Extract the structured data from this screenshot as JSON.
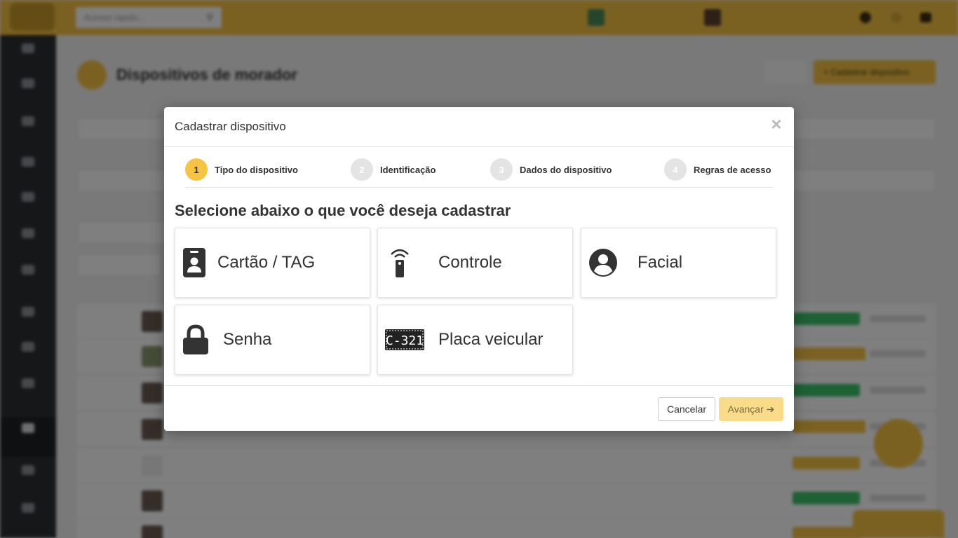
{
  "modal": {
    "title": "Cadastrar dispositivo",
    "close_symbol": "×",
    "steps": [
      {
        "number": "1",
        "label": "Tipo do dispositivo",
        "active": true
      },
      {
        "number": "2",
        "label": "Identificação",
        "active": false
      },
      {
        "number": "3",
        "label": "Dados do dispositivo",
        "active": false
      },
      {
        "number": "4",
        "label": "Regras de acesso",
        "active": false
      }
    ],
    "section_title": "Selecione abaixo o que você deseja cadastrar",
    "options": [
      {
        "label": "Cartão / TAG",
        "icon": "id-badge-icon"
      },
      {
        "label": "Controle",
        "icon": "remote-control-icon"
      },
      {
        "label": "Facial",
        "icon": "user-circle-icon"
      },
      {
        "label": "Senha",
        "icon": "lock-icon"
      },
      {
        "label": "Placa veicular",
        "icon": "license-plate-icon",
        "plate_text": "C-321"
      }
    ],
    "footer": {
      "cancel_label": "Cancelar",
      "next_label": "Avançar",
      "next_arrow": "➔"
    }
  },
  "background": {
    "page_title": "Dispositivos de morador",
    "search_placeholder": "Acesso rápido...",
    "add_button_label": "+ Cadastrar dispositivo"
  },
  "colors": {
    "accent": "#f6c343",
    "step_inactive": "#e4e4e4",
    "next_button_disabled": "#f9dc8a",
    "sidebar": "#2b2f33"
  }
}
